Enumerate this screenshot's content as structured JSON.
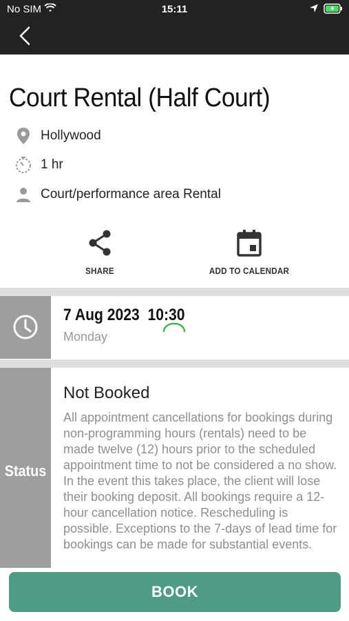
{
  "status_bar": {
    "carrier": "No SIM",
    "time": "15:11"
  },
  "event": {
    "title": "Court Rental (Half Court)",
    "location": "Hollywood",
    "duration": "1 hr",
    "category": "Court/performance area Rental"
  },
  "actions": {
    "share_label": "SHARE",
    "calendar_label": "ADD TO CALENDAR"
  },
  "schedule": {
    "date": "7 Aug 2023",
    "time": "10:30",
    "weekday": "Monday"
  },
  "booking": {
    "status_label": "Status",
    "status": "Not Booked",
    "policy": "All appointment cancellations for bookings during non-programming hours (rentals) need to be made twelve (12) hours prior to the scheduled appointment time to not be considered a no show. In the event this takes place, the client will lose their booking deposit. All bookings require a 12-hour cancellation notice. Rescheduling is possible. Exceptions to the 7-days of lead time for bookings can be made for substantial events."
  },
  "book_button_label": "BOOK",
  "colors": {
    "accent": "#4e9b86",
    "side_panel": "#9e9e9e",
    "navbar": "#222222"
  },
  "icons": [
    "back-chevron-icon",
    "map-pin-icon",
    "timer-icon",
    "person-icon",
    "share-icon",
    "calendar-icon",
    "clock-icon",
    "loading-spinner-icon"
  ]
}
